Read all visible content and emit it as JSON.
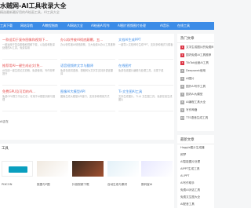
{
  "header": {
    "title": "水贼网-AI工具收录大全",
    "subtitle": "精选最新最好用的AI绘画工具，AI工具大全"
  },
  "nav": {
    "items": [
      "工具下载",
      "网站导航",
      "AI教程指南",
      "AI网站大全",
      "AI绘画AI写作",
      "AI图片视频图片处理",
      "AI音乐",
      "在线工具"
    ]
  },
  "main": {
    "rows": [
      [
        {
          "title": "一款适用于复杂图像和视频下...",
          "desc": "一款适用于复杂图像和视频下载，以及各种批量处理的AI工具，免费易用",
          "color": "red"
        },
        {
          "title": "办公软件被AI彻底颠覆，五...",
          "desc": "办公软件被AI彻底颠覆，五大免费AI办公工具推荐",
          "color": "red"
        },
        {
          "title": "文档AI生成PPT",
          "desc": "一键导入文档即可生成PPT，支持多种格式与模板",
          "color": "blue"
        }
      ],
      [
        {
          "title": "推荐用AI一键生成论文(免...",
          "desc": "AI在线一键生成论文初稿，免费使用，写作效率提升",
          "color": "red"
        },
        {
          "title": "语音视频转文字与翻译",
          "desc": "免费在线将语音、视频转为文字并支持多语言翻译",
          "color": "blue"
        },
        {
          "title": "在线图片",
          "desc": "免费在线图片编辑与处理工具，无需下载",
          "color": "blue"
        }
      ],
      [
        {
          "title": "免费GPU及可用的AI...",
          "desc": "免费GPU算力平台汇总，可用于AI模型训练与推理",
          "color": "red"
        },
        {
          "title": "图像AI大模型API",
          "desc": "图像生成大模型API接口，支持多种调用方式",
          "color": "blue"
        },
        {
          "title": "Ti-文生图AI工具",
          "desc": "文本生成图片，Ti-Ai 文生图工具，免费在线生成图片",
          "color": "blue"
        }
      ]
    ],
    "sliver": "AI正在"
  },
  "sidebar": {
    "hot_title": "热门文章",
    "hot_items": [
      "文字生成图片的免费网站推荐",
      "国内免费AI工具推荐",
      "TikTok运营AI工具",
      "Deepseek使用",
      "AI图片",
      "国外AI写作工具",
      "国内AI大模型",
      "AI编程工具大全",
      "写作神器",
      "TTS语音生成工具"
    ],
    "latest_title": "最新文章",
    "latest_items": [
      "Haggle图片生成器",
      "即梦",
      "AI智能图片处理",
      "AIPPT生成工具",
      "AI-PPT",
      "AI写作助手",
      "免费AI对话工具",
      "免费文生图大全",
      "AI配音工具"
    ]
  },
  "bottom": {
    "label": "工具",
    "items": [
      {
        "caption": "PIXCON"
      },
      {
        "caption": "抠图与P图"
      },
      {
        "caption": "抖音视频下载"
      },
      {
        "caption": "自动生成与素材"
      },
      {
        "caption": "数码宝AI"
      }
    ]
  },
  "colors": {
    "accent": "#3c8ce7",
    "red": "#e54b4b"
  }
}
